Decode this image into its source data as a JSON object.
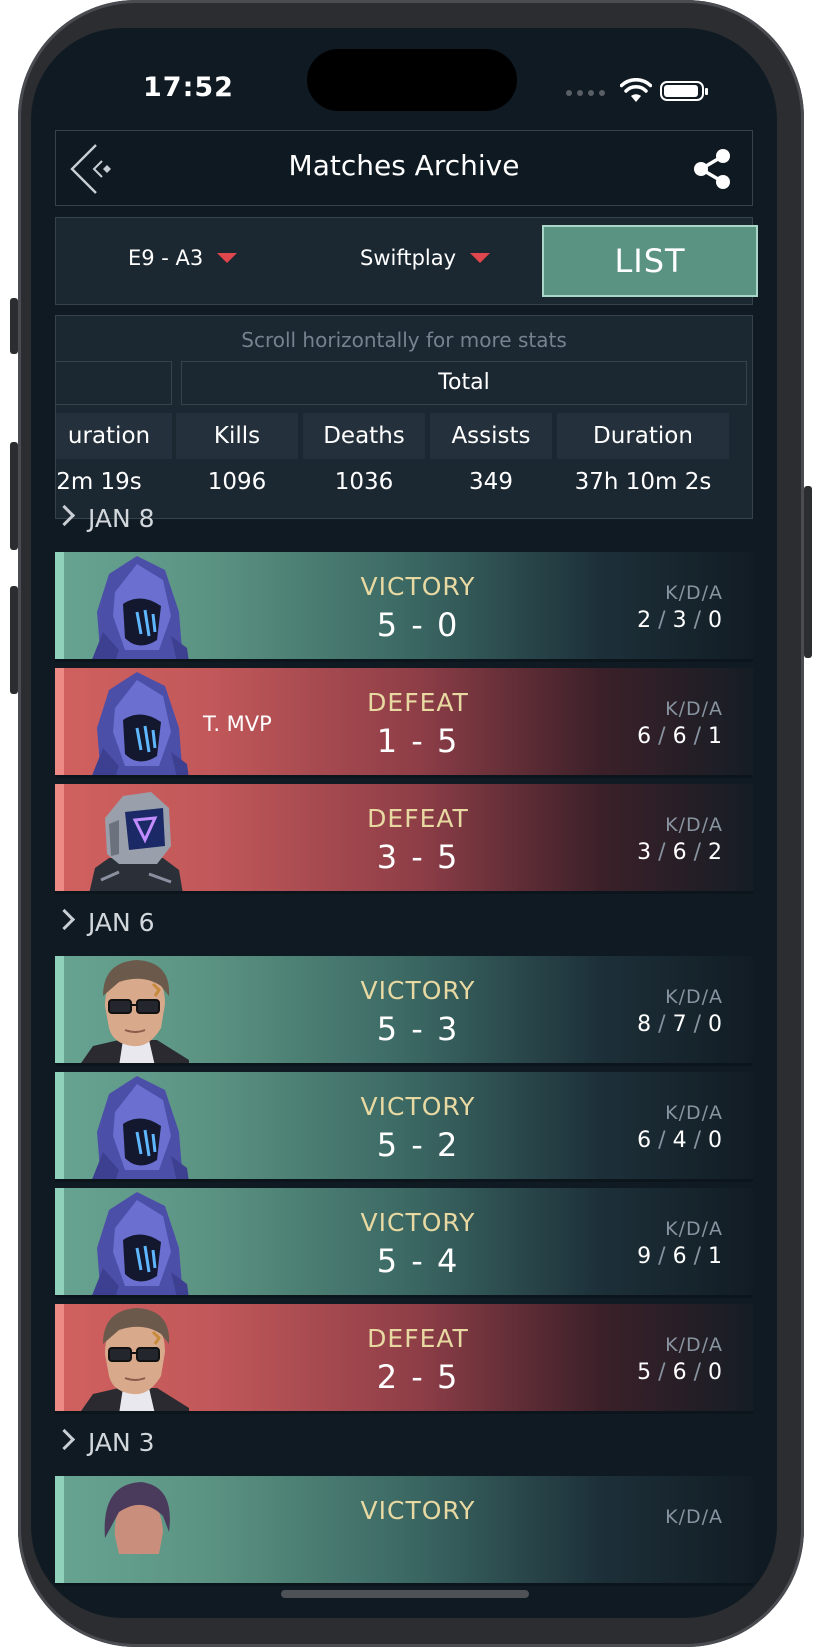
{
  "status_bar": {
    "time": "17:52"
  },
  "header": {
    "title": "Matches Archive"
  },
  "filters": {
    "act": "E9 - A3",
    "mode": "Swiftplay",
    "view_button": "LIST"
  },
  "stats": {
    "scroll_hint": "Scroll horizontally for more stats",
    "group_label": "Total",
    "partial_header": "uration",
    "partial_value": "2m 19s",
    "columns": [
      {
        "label": "Kills",
        "value": "1096"
      },
      {
        "label": "Deaths",
        "value": "1036"
      },
      {
        "label": "Assists",
        "value": "349"
      },
      {
        "label": "Duration",
        "value": "37h 10m 2s"
      }
    ]
  },
  "kda_label": "K/D/A",
  "groups": [
    {
      "date": "JAN 8",
      "matches": [
        {
          "outcome": "win",
          "result": "VICTORY",
          "score": "5 - 0",
          "kda": [
            "2",
            "3",
            "0"
          ],
          "agent": "hooded-agent",
          "mvp": ""
        },
        {
          "outcome": "loss",
          "result": "DEFEAT",
          "score": "1 - 5",
          "kda": [
            "6",
            "6",
            "1"
          ],
          "agent": "hooded-agent",
          "mvp": "T. MVP"
        },
        {
          "outcome": "loss",
          "result": "DEFEAT",
          "score": "3 - 5",
          "kda": [
            "3",
            "6",
            "2"
          ],
          "agent": "robot-agent",
          "mvp": ""
        }
      ]
    },
    {
      "date": "JAN 6",
      "matches": [
        {
          "outcome": "win",
          "result": "VICTORY",
          "score": "5 - 3",
          "kda": [
            "8",
            "7",
            "0"
          ],
          "agent": "glasses-agent",
          "mvp": ""
        },
        {
          "outcome": "win",
          "result": "VICTORY",
          "score": "5 - 2",
          "kda": [
            "6",
            "4",
            "0"
          ],
          "agent": "hooded-agent",
          "mvp": ""
        },
        {
          "outcome": "win",
          "result": "VICTORY",
          "score": "5 - 4",
          "kda": [
            "9",
            "6",
            "1"
          ],
          "agent": "hooded-agent",
          "mvp": ""
        },
        {
          "outcome": "loss",
          "result": "DEFEAT",
          "score": "2 - 5",
          "kda": [
            "5",
            "6",
            "0"
          ],
          "agent": "glasses-agent",
          "mvp": ""
        }
      ]
    },
    {
      "date": "JAN 3",
      "matches": [
        {
          "outcome": "win",
          "result": "VICTORY",
          "score": "",
          "kda": [],
          "agent": "purple-hair-agent",
          "mvp": ""
        }
      ]
    }
  ],
  "colors": {
    "victory": "#5b9382",
    "defeat": "#c2585a",
    "accent_red": "#e0474d",
    "result_gold": "#e8d9a2"
  }
}
